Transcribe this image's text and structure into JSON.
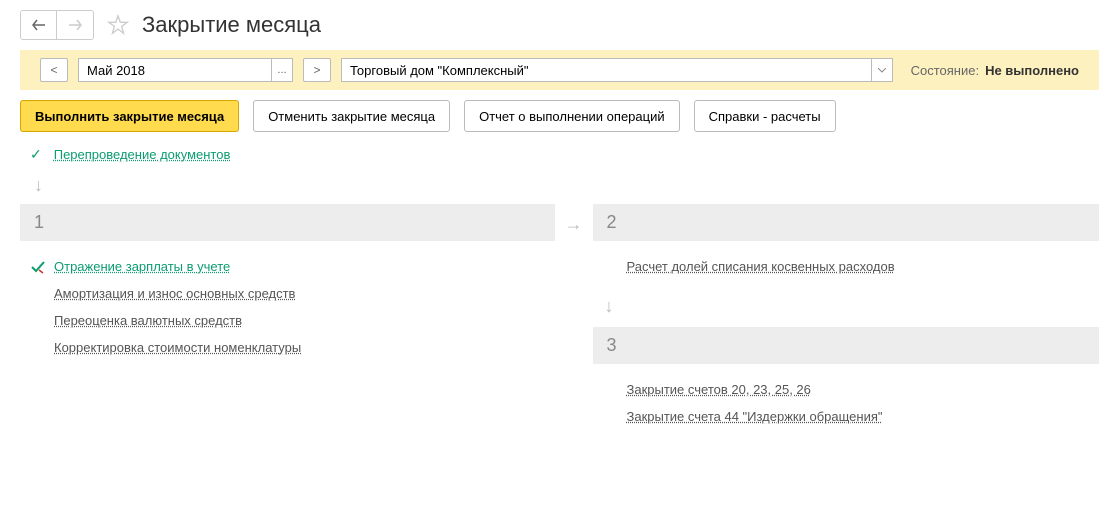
{
  "header": {
    "title": "Закрытие месяца"
  },
  "filter": {
    "prev": "<",
    "next": ">",
    "period": "Май 2018",
    "org": "Торговый дом \"Комплексный\"",
    "status_label": "Состояние:",
    "status_value": "Не выполнено"
  },
  "actions": {
    "execute": "Выполнить закрытие месяца",
    "cancel": "Отменить закрытие месяца",
    "report": "Отчет о выполнении операций",
    "refs": "Справки - расчеты"
  },
  "prestep": {
    "label": "Перепроведение документов"
  },
  "stages": {
    "s1": {
      "num": "1",
      "items": [
        {
          "label": "Отражение зарплаты в учете"
        },
        {
          "label": "Амортизация и износ основных средств"
        },
        {
          "label": "Переоценка валютных средств"
        },
        {
          "label": "Корректировка стоимости номенклатуры"
        }
      ]
    },
    "s2": {
      "num": "2",
      "items": [
        {
          "label": "Расчет долей списания косвенных расходов"
        }
      ]
    },
    "s3": {
      "num": "3",
      "items": [
        {
          "label": "Закрытие счетов 20, 23, 25, 26"
        },
        {
          "label": "Закрытие счета 44 \"Издержки обращения\""
        }
      ]
    }
  }
}
